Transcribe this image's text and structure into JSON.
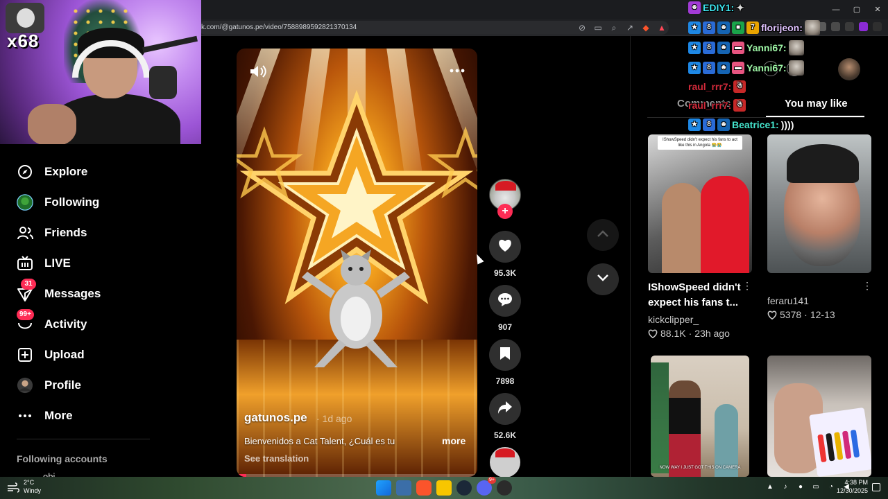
{
  "browser": {
    "url": "k.com/@gatunos.pe/video/7588989592821370134",
    "window_controls": [
      "—",
      "▢",
      "✕"
    ]
  },
  "webcam": {
    "overlay_text": "x68"
  },
  "sidebar": {
    "items": [
      {
        "label": "Explore",
        "icon": "compass-icon",
        "badge": ""
      },
      {
        "label": "Following",
        "icon": "following-avatar-icon",
        "badge": ""
      },
      {
        "label": "Friends",
        "icon": "friends-icon",
        "badge": ""
      },
      {
        "label": "LIVE",
        "icon": "live-tv-icon",
        "badge": ""
      },
      {
        "label": "Messages",
        "icon": "messages-icon",
        "badge": "31"
      },
      {
        "label": "Activity",
        "icon": "activity-icon",
        "badge": "99+"
      },
      {
        "label": "Upload",
        "icon": "upload-icon",
        "badge": ""
      },
      {
        "label": "Profile",
        "icon": "profile-avatar-icon",
        "badge": ""
      },
      {
        "label": "More",
        "icon": "more-dots-icon",
        "badge": ""
      }
    ],
    "following_accounts_title": "Following accounts",
    "following_first_partial": "obj"
  },
  "video": {
    "author": "gatunos.pe",
    "posted": "· 1d ago",
    "caption": "Bienvenidos a Cat Talent, ¿Cuál es tu",
    "more_label": "more",
    "translate_label": "See translation",
    "progress_fraction": 0.04
  },
  "actions": {
    "likes": "95.3K",
    "comments": "907",
    "saves": "7898",
    "shares": "52.6K",
    "follow_symbol": "+"
  },
  "right_panel": {
    "tabs": [
      "Comments",
      "You may like"
    ],
    "active_tab": "You may like",
    "cards": [
      {
        "title_line1": "IShowSpeed didn't",
        "title_line2": "expect his fans t...",
        "author": "kickclipper_",
        "likes": "88.1K",
        "age": "23h ago",
        "thumb_caption": "IShowSpeed didn't expect his fans to act like this in Angola 😭😭"
      },
      {
        "author": "feraru141",
        "likes": "5378",
        "age": "12-13"
      },
      {
        "thumb_caption": "NOW WAY I JUST GOT THIS ON CAMERA"
      },
      {}
    ]
  },
  "chat": [
    {
      "user": "EDIY1:",
      "color": "#3ee6f0",
      "message": ""
    },
    {
      "user": "florijeon:",
      "color": "#e0c3ff",
      "message": ""
    },
    {
      "user": "Yanni67:",
      "color": "#9ef5a6",
      "message": ""
    },
    {
      "user": "Yanni67:",
      "color": "#9ef5a6",
      "message": ""
    },
    {
      "user": "raul_rrr7:",
      "color": "#d12a3a",
      "message": ""
    },
    {
      "user": "raul_rrr7:",
      "color": "#d12a3a",
      "message": ""
    },
    {
      "user": "Beatrice1:",
      "color": "#46e8d0",
      "message": "))))"
    }
  ],
  "taskbar": {
    "weather_temp": "2°C",
    "weather_desc": "Windy",
    "time": "4:38 PM",
    "date": "12/30/2025",
    "discord_badge": "9+"
  },
  "colors": {
    "accent": "#fe2c55",
    "background": "#000000",
    "text": "#ffffff",
    "muted": "#a9a9a9"
  }
}
